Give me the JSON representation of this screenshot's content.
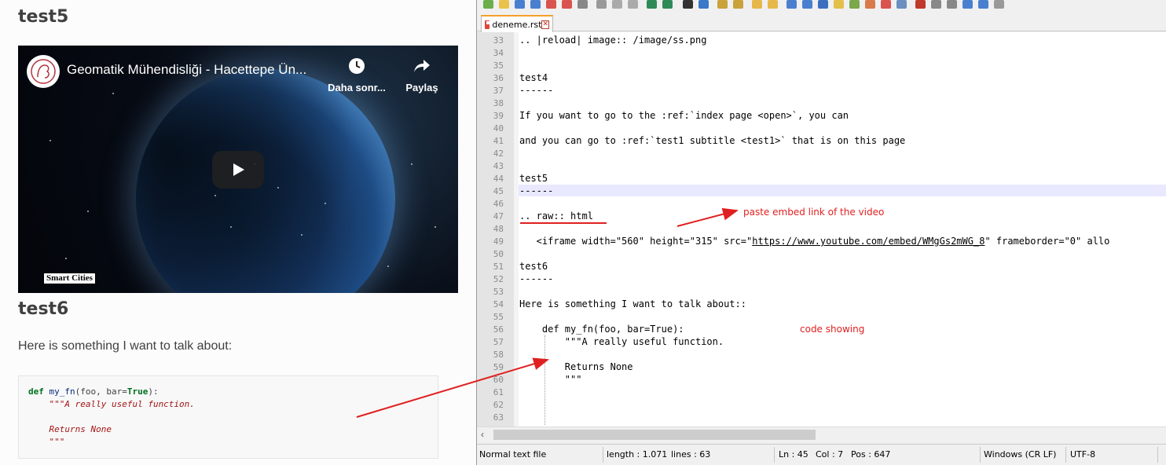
{
  "docs": {
    "heading_test5": "test5",
    "heading_test6": "test6",
    "video": {
      "title": "Geomatik Mühendisliği - Hacettepe Ün...",
      "watch_later_label": "Daha sonr...",
      "share_label": "Paylaş",
      "badge": "Smart Cities"
    },
    "paragraph": "Here is something I want to talk about:",
    "code": {
      "def_kw": "def",
      "fn_name": "my_fn",
      "params_open": "(foo, bar=",
      "true_kw": "True",
      "params_close": "):",
      "doc1": "    \"\"\"A really useful function.",
      "doc2": "",
      "doc3": "    Returns None",
      "doc4": "    \"\"\""
    }
  },
  "editor": {
    "tab_name": "deneme.rst",
    "line_numbers": [
      "33",
      "34",
      "35",
      "36",
      "37",
      "38",
      "39",
      "40",
      "41",
      "42",
      "43",
      "44",
      "45",
      "46",
      "47",
      "48",
      "49",
      "50",
      "51",
      "52",
      "53",
      "54",
      "55",
      "56",
      "57",
      "58",
      "59",
      "60",
      "61",
      "62",
      "63"
    ],
    "lines": {
      "l33": ".. |reload| image:: /image/ss.png",
      "l36": "test4",
      "l37": "------",
      "l39": "If you want to go to the :ref:`index page <open>`, you can",
      "l41": "and you can go to :ref:`test1 subtitle <test1>` that is on this page",
      "l44": "test5",
      "l45": "------",
      "l47": ".. raw:: html",
      "l49_pre": "   <iframe width=\"560\" height=\"315\" src=\"",
      "l49_link": "https://www.youtube.com/embed/WMgGs2mWG_8",
      "l49_post": "\" frameborder=\"0\" allo",
      "l51": "test6",
      "l52": "------",
      "l54": "Here is something I want to talk about::",
      "l56": "    def my_fn(foo, bar=True):",
      "l57": "        \"\"\"A really useful function.",
      "l59": "        Returns None",
      "l60": "        \"\"\""
    }
  },
  "statusbar": {
    "file_type": "Normal text file",
    "length": "length : 1.071",
    "lines": "lines : 63",
    "ln": "Ln : 45",
    "col": "Col : 7",
    "pos": "Pos : 647",
    "eol": "Windows (CR LF)",
    "encoding": "UTF-8"
  },
  "annotations": {
    "paste_note": "paste  embed link of the video",
    "code_note": "code showing",
    "color": "#e02020"
  }
}
